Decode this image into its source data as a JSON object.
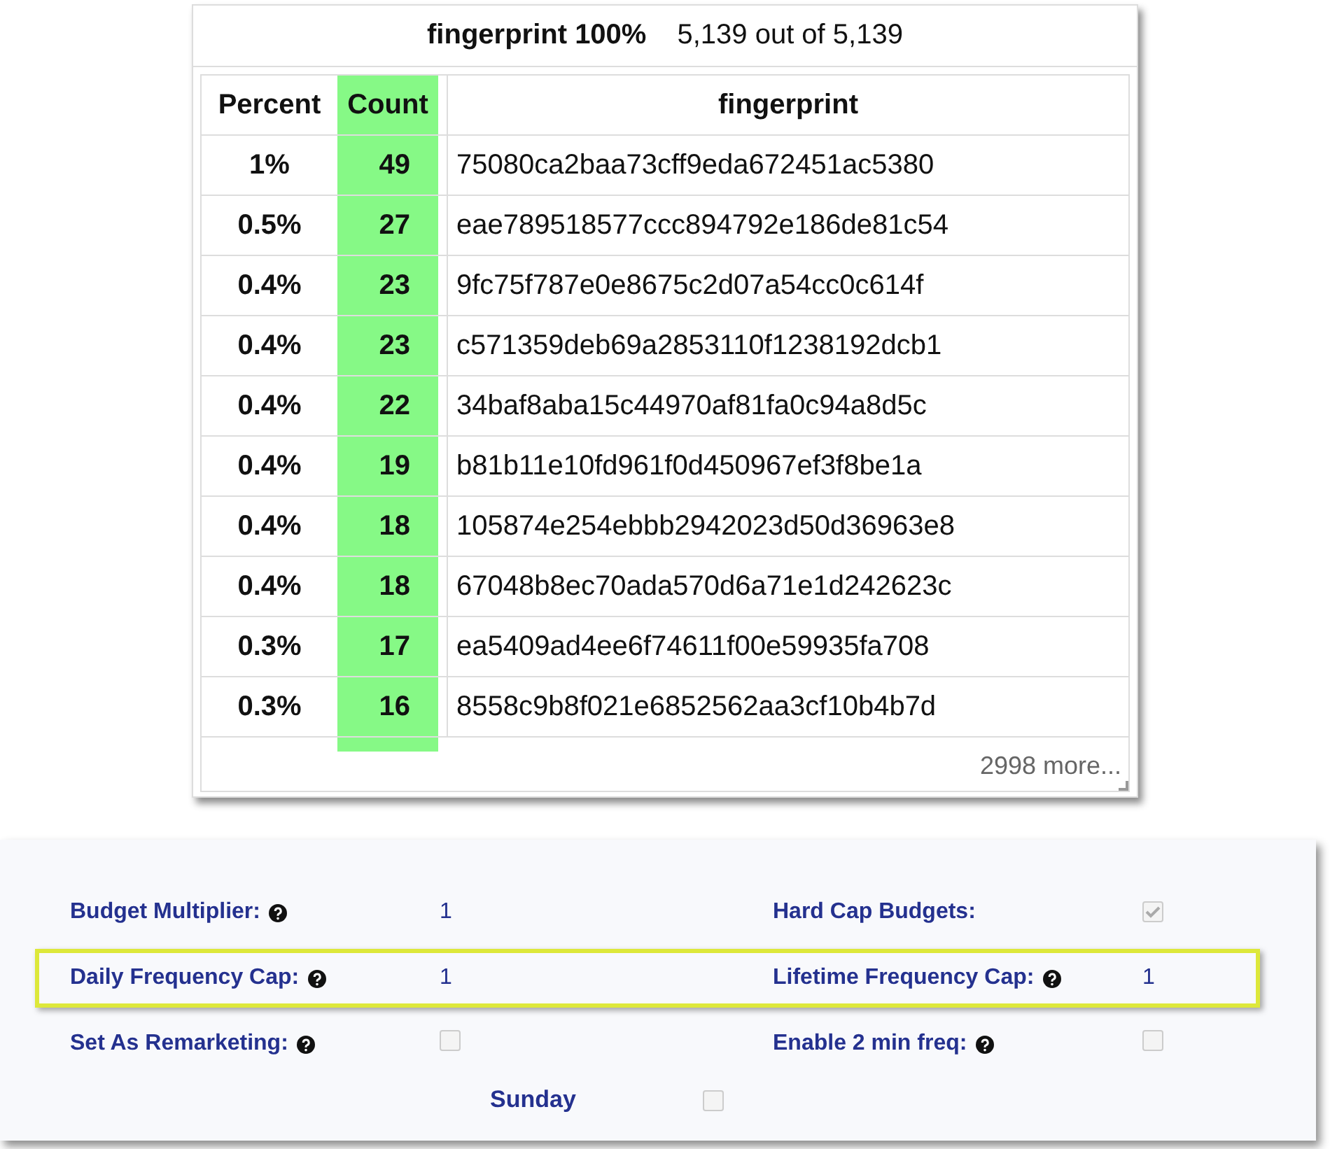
{
  "summary": {
    "title": "fingerprint 100%",
    "count": "5,139 out of 5,139"
  },
  "table": {
    "columns": [
      {
        "label": "Percent",
        "highlighted": false
      },
      {
        "label": "Count",
        "highlighted": true
      },
      {
        "label": "fingerprint",
        "highlighted": false
      }
    ],
    "rows": [
      {
        "percent": "1%",
        "count": "49",
        "fingerprint": "75080ca2baa73cff9eda672451ac5380"
      },
      {
        "percent": "0.5%",
        "count": "27",
        "fingerprint": "eae789518577ccc894792e186de81c54"
      },
      {
        "percent": "0.4%",
        "count": "23",
        "fingerprint": "9fc75f787e0e8675c2d07a54cc0c614f"
      },
      {
        "percent": "0.4%",
        "count": "23",
        "fingerprint": "c571359deb69a2853110f1238192dcb1"
      },
      {
        "percent": "0.4%",
        "count": "22",
        "fingerprint": "34baf8aba15c44970af81fa0c94a8d5c"
      },
      {
        "percent": "0.4%",
        "count": "19",
        "fingerprint": "b81b11e10fd961f0d450967ef3f8be1a"
      },
      {
        "percent": "0.4%",
        "count": "18",
        "fingerprint": "105874e254ebbb2942023d50d36963e8"
      },
      {
        "percent": "0.4%",
        "count": "18",
        "fingerprint": "67048b8ec70ada570d6a71e1d242623c"
      },
      {
        "percent": "0.3%",
        "count": "17",
        "fingerprint": "ea5409ad4ee6f74611f00e59935fa708"
      },
      {
        "percent": "0.3%",
        "count": "16",
        "fingerprint": "8558c9b8f021e6852562aa3cf10b4b7d"
      }
    ],
    "more": "2998 more..."
  },
  "form": {
    "rows": [
      {
        "highlighted": false,
        "left": {
          "label": "Budget Multiplier:",
          "help": true,
          "kind": "text",
          "value": "1"
        },
        "right": {
          "label": "Hard Cap Budgets:",
          "help": false,
          "kind": "checkbox",
          "checked": true
        }
      },
      {
        "highlighted": true,
        "left": {
          "label": "Daily Frequency Cap:",
          "help": true,
          "kind": "text",
          "value": "1"
        },
        "right": {
          "label": "Lifetime Frequency Cap:",
          "help": true,
          "kind": "text",
          "value": "1"
        }
      },
      {
        "highlighted": false,
        "left": {
          "label": "Set As Remarketing:",
          "help": true,
          "kind": "checkbox",
          "checked": false
        },
        "right": {
          "label": "Enable 2 min freq:",
          "help": true,
          "kind": "checkbox",
          "checked": false
        }
      }
    ],
    "days": [
      {
        "label": "Sunday",
        "checked": false
      }
    ]
  }
}
